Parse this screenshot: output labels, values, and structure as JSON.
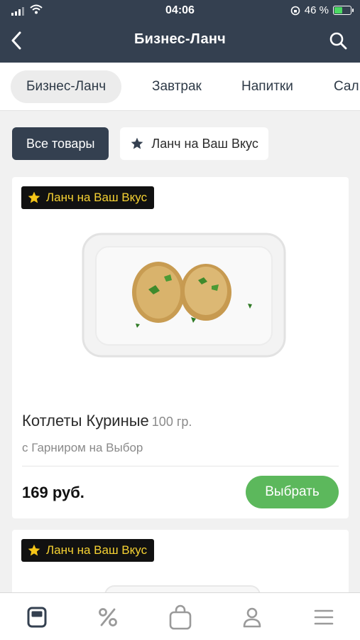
{
  "status_bar": {
    "time": "04:06",
    "battery": "46 %",
    "battery_level": 0.46
  },
  "nav": {
    "title": "Бизнес-Ланч"
  },
  "categories": [
    {
      "label": "Бизнес-Ланч",
      "active": true
    },
    {
      "label": "Завтрак",
      "active": false
    },
    {
      "label": "Напитки",
      "active": false
    },
    {
      "label": "Сал",
      "active": false
    }
  ],
  "filters": [
    {
      "label": "Все товары",
      "active": true
    },
    {
      "label": "Ланч на Ваш Вкус",
      "active": false,
      "icon": "star-icon"
    }
  ],
  "products": [
    {
      "badge": "Ланч на Ваш Вкус",
      "name": "Котлеты  Куриные",
      "weight": "100 гр.",
      "description": "с Гарниром на Выбор",
      "price": "169 руб.",
      "button": "Выбрать"
    },
    {
      "badge": "Ланч на Ваш Вкус"
    }
  ],
  "tabbar": [
    "menu-icon",
    "percent-icon",
    "bag-icon",
    "profile-icon",
    "hamburger-icon"
  ],
  "colors": {
    "header": "#344050",
    "accent": "#5cb85c",
    "badge_text": "#f5d132"
  }
}
